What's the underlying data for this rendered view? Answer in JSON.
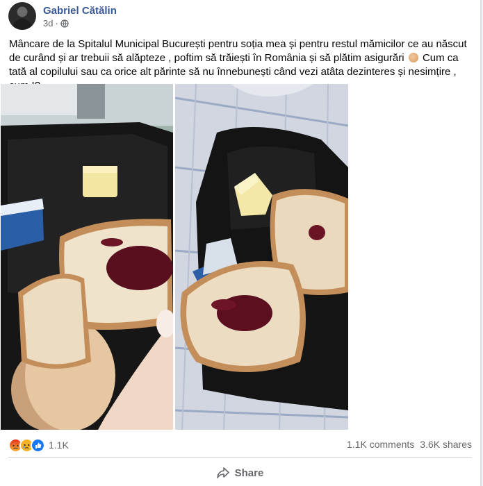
{
  "post": {
    "author": "Gabriel Cătălin",
    "time": "3d",
    "privacy_icon": "globe-icon",
    "text_part1": "Mâncare de la Spitalul Municipal București pentru soția mea și pentru restul mămicilor ce au născut de curând și ar trebuii să alăpteze , poftim să trăiești în România și să plătim asigurări",
    "text_emoji": "clapping-hands-emoji",
    "text_part2": "Cum ca tată al copilului sau ca orice alt părinte să nu înnebunești când vezi atâta dezinteres și nesimțire , cum !?"
  },
  "reactions": {
    "icons": [
      "angry-icon",
      "sad-icon",
      "like-icon"
    ],
    "count": "1.1K"
  },
  "stats": {
    "comments": "1.1K comments",
    "shares": "3.6K shares"
  },
  "actions": {
    "share_label": "Share"
  },
  "colors": {
    "author": "#385898",
    "secondary_text": "#65676b",
    "like_blue": "#1877f2",
    "angry_orange": "#e9710f",
    "sad_yellow": "#f7b125"
  }
}
